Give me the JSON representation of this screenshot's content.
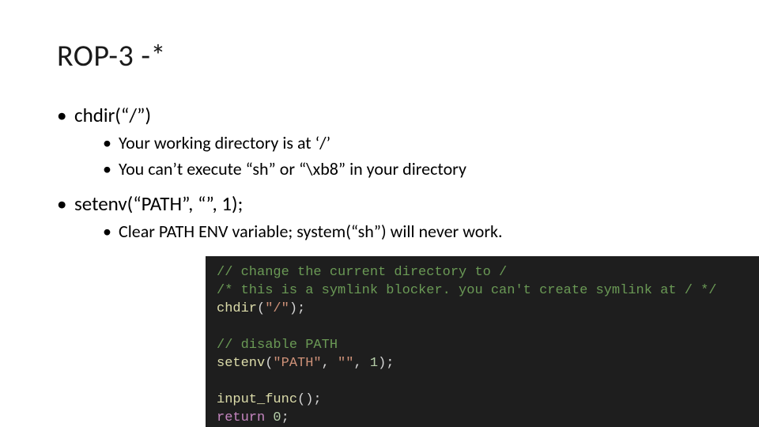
{
  "title": "ROP-3 -*",
  "bullets": [
    {
      "text": "chdir(“/”)",
      "sub": [
        "Your working directory is at ‘/’",
        "You can’t execute “sh” or “\\xb8” in your directory"
      ]
    },
    {
      "text": "setenv(“PATH”, “”, 1);",
      "sub": [
        "Clear PATH ENV variable; system(“sh”) will never work."
      ]
    }
  ],
  "code": {
    "l1": "// change the current directory to /",
    "l2": "/* this is a symlink blocker. you can't create symlink at / */",
    "l3_fn": "chdir",
    "l3_arg": "\"/\"",
    "l4": "",
    "l5": "// disable PATH",
    "l6_fn": "setenv",
    "l6_a1": "\"PATH\"",
    "l6_a2": "\"\"",
    "l6_a3": "1",
    "l7": "",
    "l8_fn": "input_func",
    "l9_kw": "return",
    "l9_val": "0"
  }
}
